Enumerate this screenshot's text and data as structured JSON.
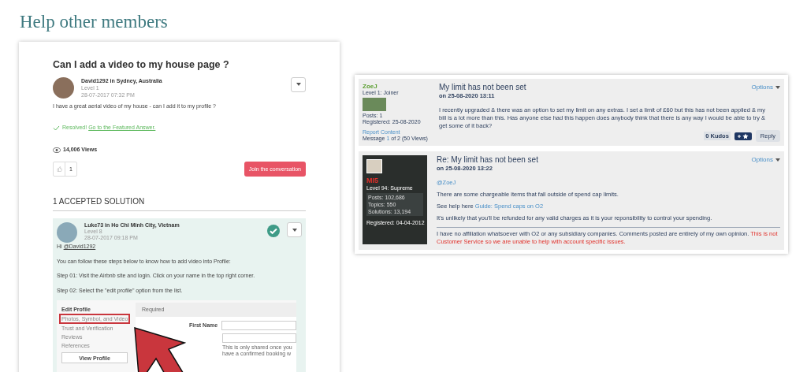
{
  "heading": "Help other members",
  "question": {
    "title": "Can I add a video to my house page ?",
    "author_line": "David1292 in Sydney, Australia",
    "level": "Level 1",
    "date": "28-07-2017 07:32 PM",
    "body": "I have a great aerial video of my house - can I add it to my profile ?",
    "resolved": "Resolved!",
    "resolved_link": "Go to the Featured Answer.",
    "views": "14,006 Views",
    "likes": "1",
    "join_button": "Join the conversation"
  },
  "solutions_heading": "1 ACCEPTED SOLUTION",
  "solution": {
    "author_line": "Luke73 in Ho Chi Minh City, Vietnam",
    "level": "Level 8",
    "date": "28-07-2017 09:18 PM",
    "accepted": true,
    "greeting": "Hi",
    "mention": "@David1292",
    "paragraphs": [
      "You can follow these steps below to know how to add video into Profile:",
      "Step 01: Visit the Airbnb site and login. Click on your name in the top right corner.",
      "Step 02: Select the \"edit profile\" option from the list."
    ],
    "embedded": {
      "menu_title": "Edit Profile",
      "menu": [
        {
          "label": "Photos, Symbol, and Video",
          "selected": true
        },
        {
          "label": "Trust and Verification",
          "selected": false
        },
        {
          "label": "Reviews",
          "selected": false
        },
        {
          "label": "References",
          "selected": false
        }
      ],
      "view_button": "View Profile",
      "section": "Required",
      "field_label": "First Name",
      "hint": "This is only shared once you have a confirmed booking w"
    }
  },
  "thread": [
    {
      "kind": "plain",
      "author": "ZoeJ",
      "rank": "Level 1: Joiner",
      "stats": [
        "Posts: 1",
        "Registered: 25-08-2020"
      ],
      "title": "My limit has not been set",
      "date": "on 25-08-2020 13:11",
      "options": "Options",
      "paragraphs": [
        [
          {
            "text": "I recently upgraded & there was an option to set my limit on any extras. I set a limit of £60 but this has not been applied & my bill is a lot more than this. Has anyone else had this happen does anybody think that there is any way I would be able to try & get some of it back?"
          }
        ]
      ],
      "report": "Report Content",
      "message_prefix": "Message",
      "message_index": "1",
      "message_suffix": "of 2 (50 Views)",
      "kudos": "0 Kudos",
      "reply": "Reply"
    },
    {
      "kind": "card",
      "author": "MI5",
      "rank": "Level 94: Supreme",
      "stats": [
        "Posts: 102,686",
        "Topics: 550",
        "Solutions: 13,194"
      ],
      "registered": "Registered: 04-04-2012",
      "title": "Re: My limit has not been set",
      "date": "on 25-08-2020 13:22",
      "options": "Options",
      "paragraphs": [
        [
          {
            "text": "@ZoeJ",
            "link": true
          }
        ],
        [
          {
            "text": "There are some chargeable items that fall outside of spend cap limits."
          }
        ],
        [
          {
            "text": "See help here "
          },
          {
            "text": "Guide: Spend caps on O2",
            "link": true
          }
        ],
        [
          {
            "text": "It's unlikely that you'll be refunded for any valid charges as it is your reponsibility to control your spending."
          }
        ]
      ],
      "signature": "I have no affiliation whatsoever with O2 or any subsidiary companies. Comments posted are entirely of my own opinion.",
      "signature_warning": "This is not Customer Service so we are unable to help with account specific issues."
    }
  ]
}
